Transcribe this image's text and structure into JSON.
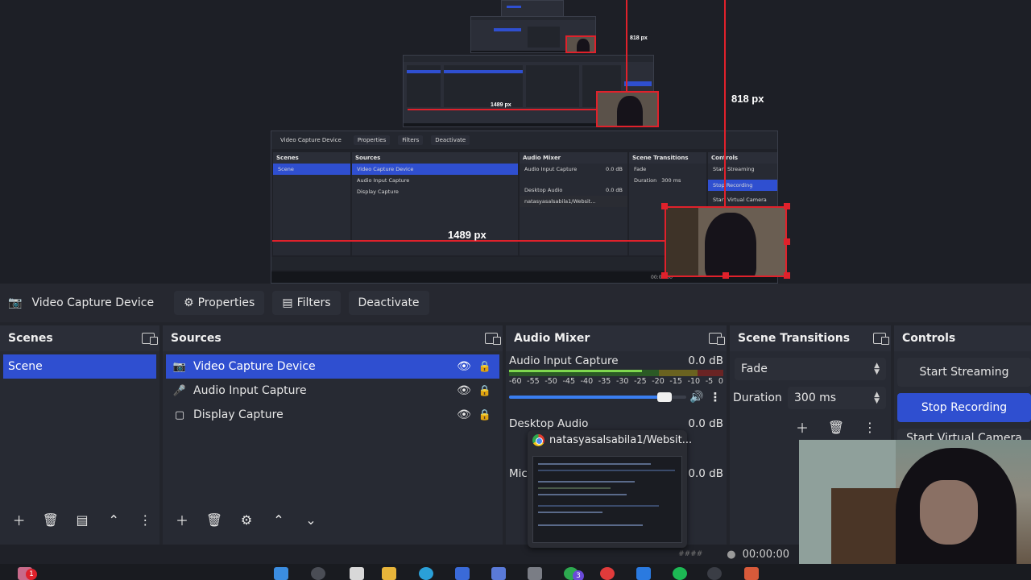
{
  "preview": {
    "dim_vertical": "818 px",
    "dim_horizontal": "1489 px",
    "dim_vertical_small": "818 px",
    "dim_horizontal_small": "1489 px",
    "nested": {
      "title": "Video Capture Device",
      "properties": "Properties",
      "filters": "Filters",
      "deactivate": "Deactivate",
      "scenes_header": "Scenes",
      "scene_item": "Scene",
      "sources_header": "Sources",
      "sources": [
        "Video Capture Device",
        "Audio Input Capture",
        "Display Capture"
      ],
      "mixer_header": "Audio Mixer",
      "mixer_channel": "Audio Input Capture",
      "mixer_db": "0.0 dB",
      "mixer_channel2": "Desktop Audio",
      "mixer_db2": "0.0 dB",
      "popup_title": "natasyasalsabila1/Websit...",
      "transitions_header": "Scene Transitions",
      "transition": "Fade",
      "duration_label": "Duration",
      "duration_value": "300 ms",
      "controls_header": "Controls",
      "start_streaming": "Start Streaming",
      "stop_recording": "Stop Recording",
      "start_virtual_camera": "Start Virtual Camera",
      "timer": "00:00:00"
    }
  },
  "context_bar": {
    "source_name": "Video Capture Device",
    "properties": "Properties",
    "filters": "Filters",
    "deactivate": "Deactivate"
  },
  "scenes": {
    "header": "Scenes",
    "items": [
      {
        "label": "Scene",
        "selected": true
      }
    ]
  },
  "sources": {
    "header": "Sources",
    "items": [
      {
        "label": "Video Capture Device",
        "icon": "camera-icon",
        "selected": true
      },
      {
        "label": "Audio Input Capture",
        "icon": "microphone-icon",
        "selected": false
      },
      {
        "label": "Display Capture",
        "icon": "monitor-icon",
        "selected": false
      }
    ]
  },
  "mixer": {
    "header": "Audio Mixer",
    "channels": [
      {
        "name": "Audio Input Capture",
        "db": "0.0 dB",
        "level": 0.62,
        "volume": 0.9
      },
      {
        "name": "Desktop Audio",
        "db": "0.0 dB",
        "level": 0.0,
        "volume": 0.9
      },
      {
        "name": "Mic",
        "db": "0.0 dB",
        "level": 0.0,
        "volume": 0.9
      }
    ],
    "ticks": [
      "-60",
      "-55",
      "-50",
      "-45",
      "-40",
      "-35",
      "-30",
      "-25",
      "-20",
      "-15",
      "-10",
      "-5",
      "0"
    ]
  },
  "transitions": {
    "header": "Scene Transitions",
    "selected": "Fade",
    "duration_label": "Duration",
    "duration_value": "300 ms"
  },
  "controls": {
    "header": "Controls",
    "start_streaming": "Start Streaming",
    "stop_recording": "Stop Recording",
    "start_virtual_camera": "Start Virtual Camera"
  },
  "status": {
    "timer": "00:00:00",
    "dropped": "####"
  },
  "popup": {
    "title": "natasyasalsabila1/Websit..."
  },
  "taskbar": {
    "badge_left": "1",
    "badge_mid": "3"
  },
  "colors": {
    "accent": "#2f4fd0",
    "measure_red": "#e0212b",
    "panel": "#272a33"
  }
}
